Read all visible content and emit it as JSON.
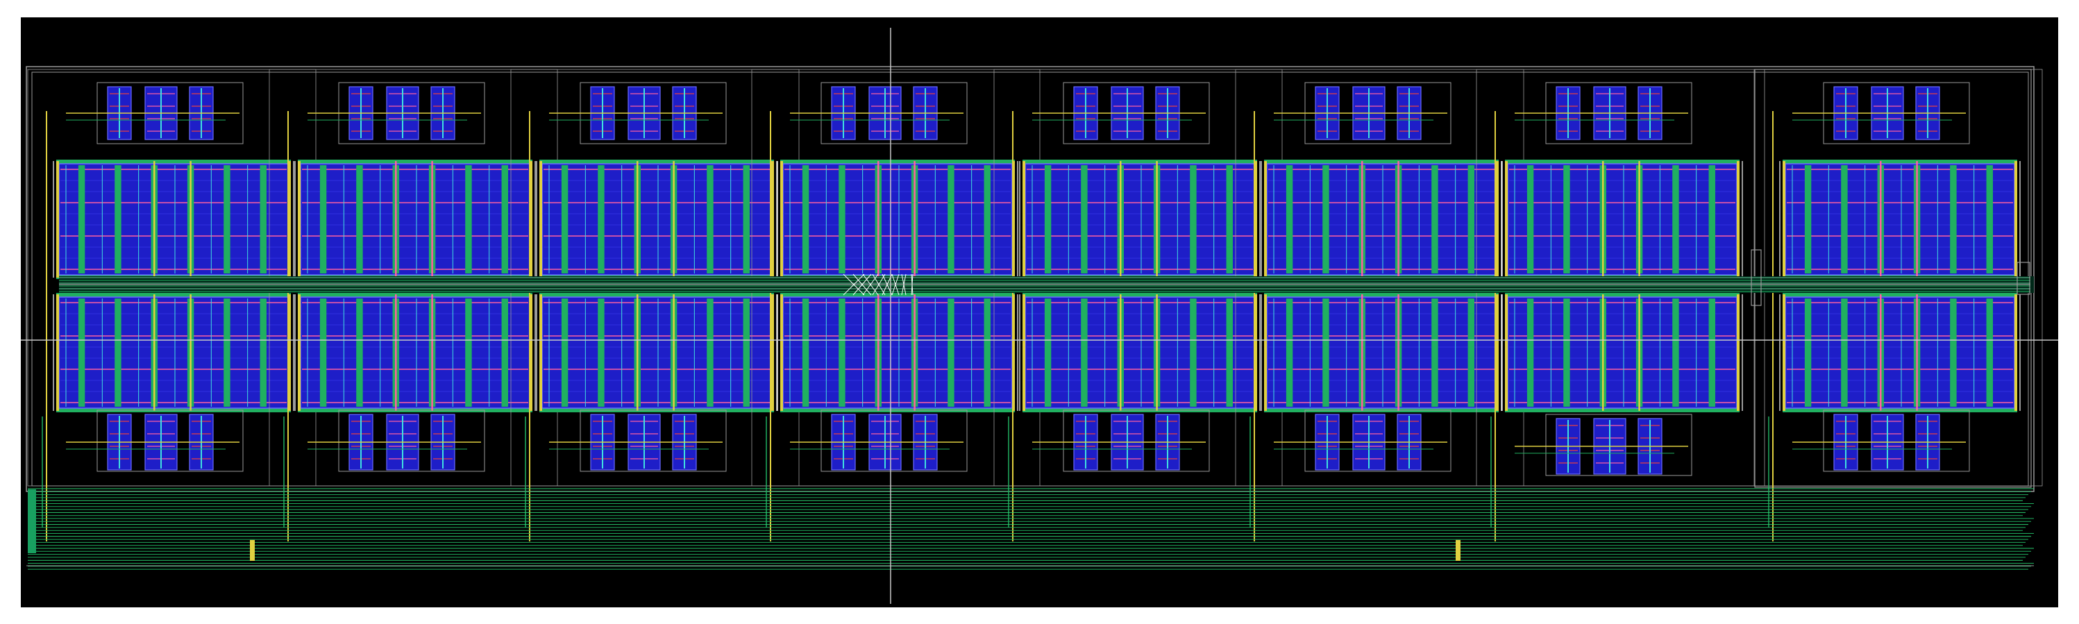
{
  "view": {
    "title": "",
    "background": "#000000",
    "border_color": "#ffffff"
  },
  "layers": {
    "boundary": "#9a9a9a",
    "diffusion_fill": "#1e1ec8",
    "diffusion_edge": "#6a6aff",
    "metal1": "#20b060",
    "metal2": "#e0d040",
    "metal3": "#ff60a0",
    "poly": "#e84040",
    "contact": "#40e0e0",
    "cursor": "#c8c8c8"
  },
  "layout": {
    "cell_columns": 8,
    "fingers_per_array": 6,
    "small_devices_per_cell": 3,
    "bus_lines": 28
  }
}
